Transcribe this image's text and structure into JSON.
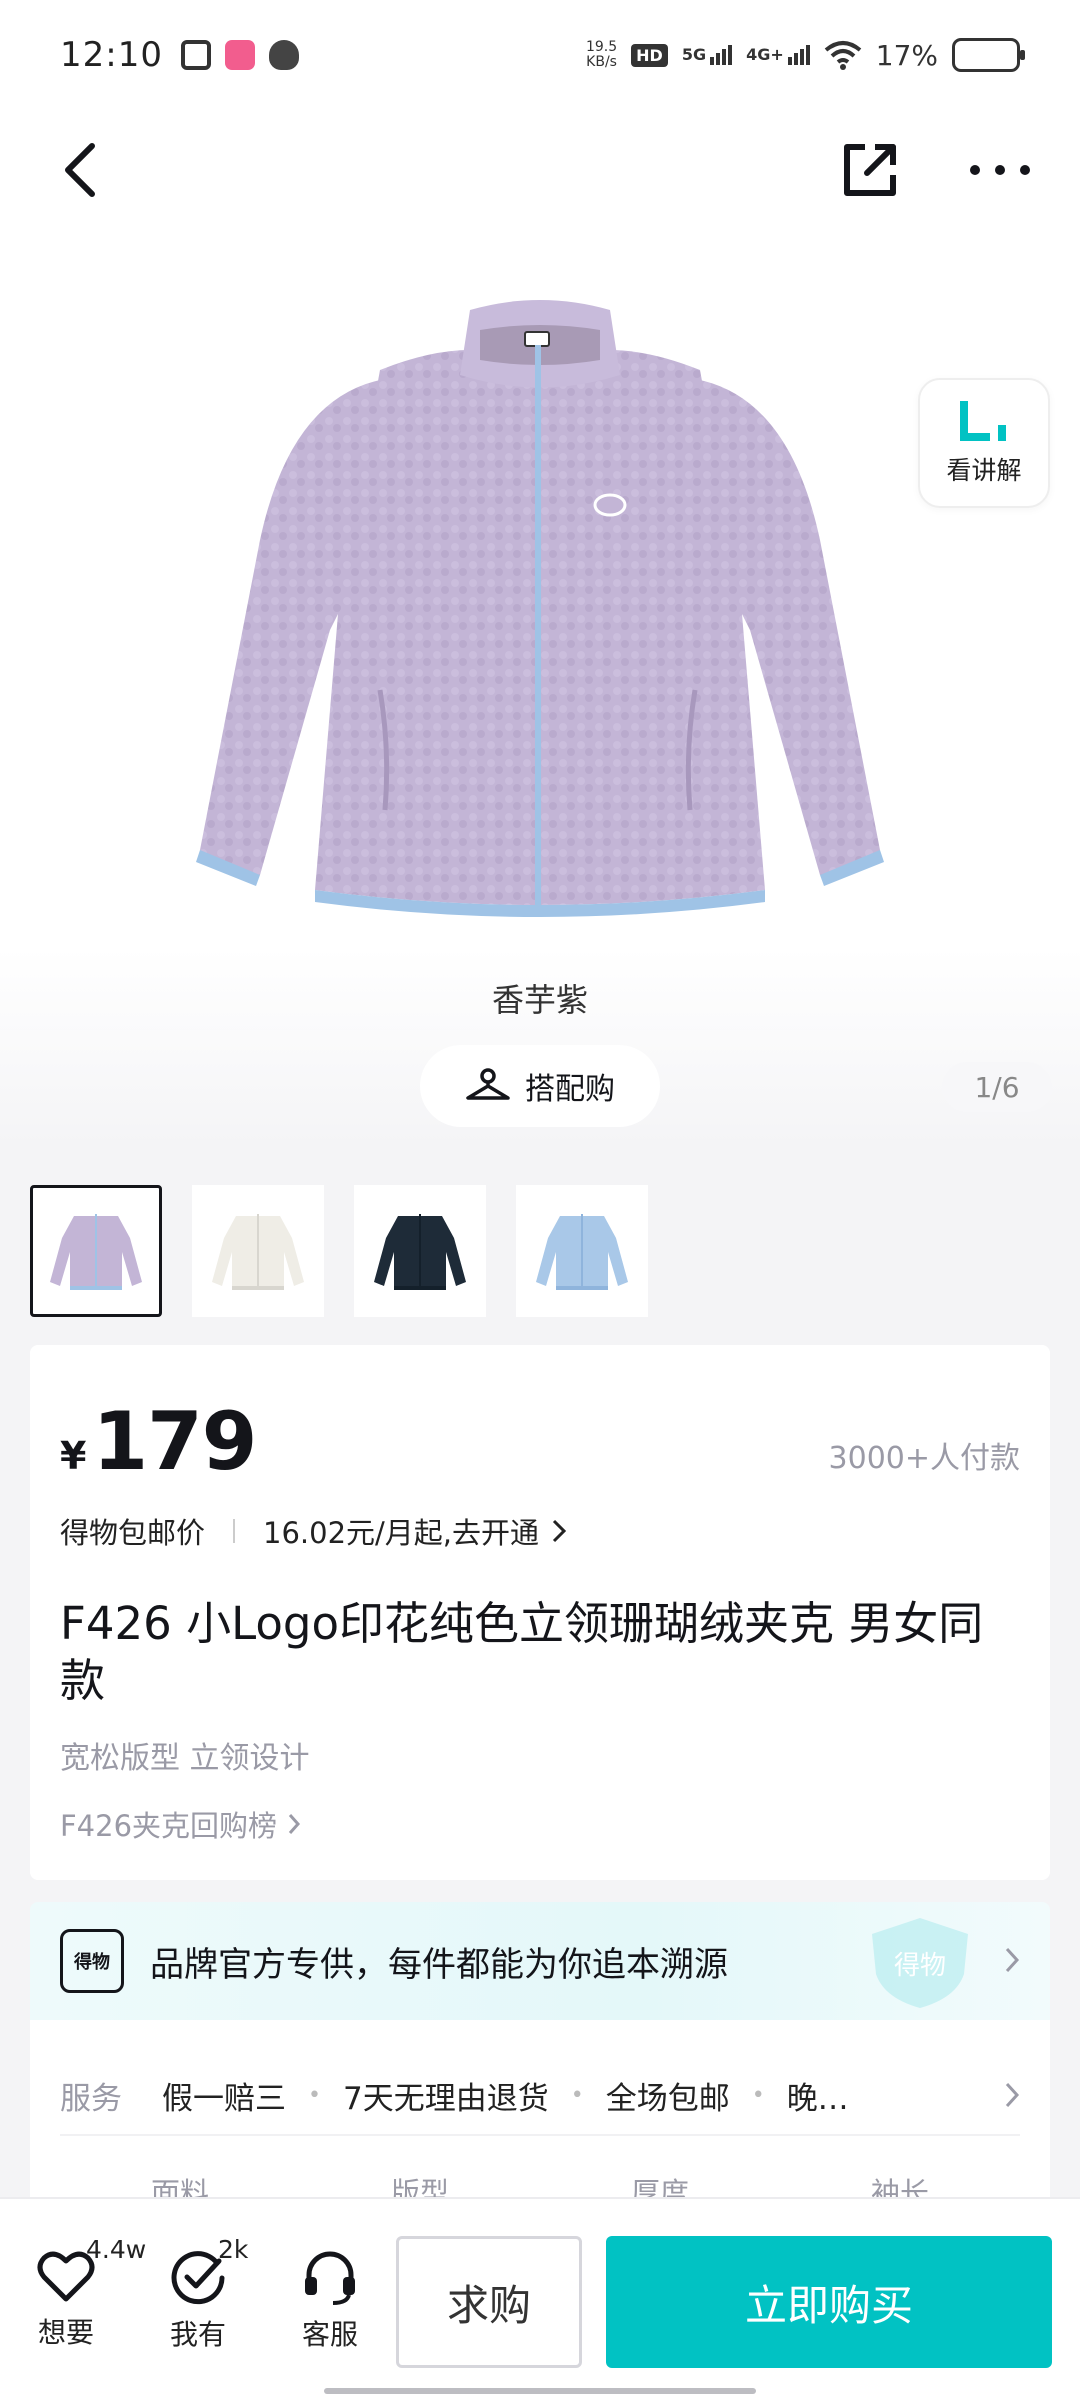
{
  "status_bar": {
    "time": "12:10",
    "net_speed_value": "19.5",
    "net_speed_unit": "KB/s",
    "hd_label": "HD",
    "signal_5g": "5G",
    "signal_4g": "4G+",
    "battery_percent": "17%"
  },
  "explain_label": "看讲解",
  "hero": {
    "color_name": "香芋紫",
    "match_label": "搭配购",
    "page_indicator": "1/6"
  },
  "thumbnails": [
    {
      "color": "#c3b5d6",
      "trim": "#9fc3e6"
    },
    {
      "color": "#efede6",
      "trim": "#d8d6cf"
    },
    {
      "color": "#1e2b38",
      "trim": "#14202b"
    },
    {
      "color": "#a9c8e8",
      "trim": "#8fb4dc"
    }
  ],
  "product": {
    "price_symbol": "¥",
    "price": "179",
    "buyers": "3000+人付款",
    "shipping": "得物包邮价",
    "installment": "16.02元/月起,去开通",
    "title": "F426 小Logo印花纯色立领珊瑚绒夹克 男女同款",
    "tags": "宽松版型 立领设计",
    "rank_link": "F426夹克回购榜"
  },
  "brand_banner": {
    "logo_text": "得物",
    "text": "品牌官方专供，每件都能为你追本溯源",
    "shield_text": "得物"
  },
  "service": {
    "label": "服务",
    "items": [
      "假一赔三",
      "7天无理由退货",
      "全场包邮",
      "晚…"
    ]
  },
  "specs": [
    "面料",
    "版型",
    "厚度",
    "袖长"
  ],
  "bottom_bar": {
    "want_label": "想要",
    "want_count": "4.4w",
    "have_label": "我有",
    "have_count": "2k",
    "service_label": "客服",
    "request_label": "求购",
    "buy_label": "立即购买"
  },
  "colors": {
    "accent": "#01c2c3",
    "product": "#c3b5d6",
    "zipper": "#9fc3e6"
  }
}
